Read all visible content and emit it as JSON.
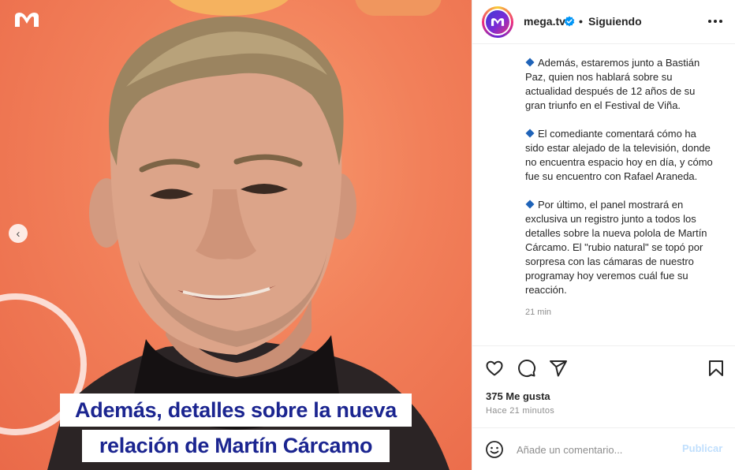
{
  "post": {
    "caption_line_1": "Además, detalles sobre la nueva",
    "caption_line_2": "relación de Martín Cárcamo",
    "carousel_prev_glyph": "‹"
  },
  "header": {
    "username": "mega.tv",
    "separator": "•",
    "follow_status": "Siguiendo"
  },
  "comments": {
    "paragraphs": [
      "Además, estaremos junto a Bastián Paz, quien nos hablará sobre su actualidad después de 12 años de su gran triunfo en el Festival de Viña.",
      "El comediante comentará cómo ha sido estar alejado de la televisión, donde no encuentra espacio hoy en día, y cómo fue su encuentro con Rafael Araneda.",
      "Por último, el panel mostrará en exclusiva un registro junto a todos los detalles sobre la nueva polola de Martín Cárcamo. El \"rubio natural\" se topó por sorpresa con las cámaras de nuestro programay hoy veremos cuál fue su reacción."
    ],
    "time_ago": "21 min"
  },
  "actions": {
    "likes": "375 Me gusta",
    "posted": "Hace 21 minutos"
  },
  "comment_bar": {
    "placeholder": "Añade un comentario...",
    "publish_label": "Publicar"
  },
  "colors": {
    "caption_text": "#1b2590",
    "verified_badge": "#0095f6",
    "diamond": "#1f63b8",
    "publish_disabled": "#c0dffd"
  },
  "icons": {
    "logo": "mega-logo-icon",
    "verified": "verified-badge-icon",
    "more": "more-options-icon",
    "like": "heart-icon",
    "comment": "comment-bubble-icon",
    "share": "paper-plane-icon",
    "save": "bookmark-icon",
    "emoji": "smiley-icon",
    "bullet": "blue-diamond-icon"
  }
}
